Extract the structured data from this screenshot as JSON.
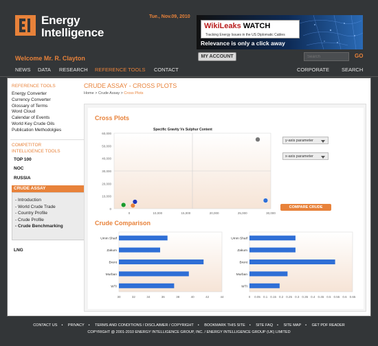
{
  "header": {
    "brand_line1": "Energy",
    "brand_line2": "Intelligence",
    "date": "Tue., Nov.09, 2010",
    "banner": {
      "title_part1": "WikiLeaks",
      "title_part2": " WATCH",
      "subtitle": "Tracking Energy Issues in the US Diplomatic Cables",
      "tagline": "Relevance is only a click away"
    },
    "welcome": "Welcome Mr. R. Clayton",
    "my_account": "MY ACCOUNT",
    "search_placeholder": "Search",
    "go": "GO"
  },
  "nav": {
    "items": [
      "NEWS",
      "DATA",
      "RESEARCH",
      "REFERENCE TOOLS",
      "CONTACT"
    ],
    "right_items": [
      "CORPORATE",
      "SEARCH"
    ]
  },
  "sidebar": {
    "reference_head": "REFERENCE TOOLS",
    "reference_items": [
      "Energy Converter",
      "Currency Converter",
      "Glossary of Terms",
      "Word Cloud",
      "Calendar of Events",
      "World Key Crude Oils",
      "Publication Methodolgies"
    ],
    "competitor_head_1": "COMPETITOR",
    "competitor_head_2": "INTELLIGENCE TOOLS",
    "top100": "TOP 100",
    "noc": "NOC",
    "russia": "RUSSIA",
    "crude_head": "CRUDE ASSAY",
    "crude_items": [
      "- Introduction",
      "- World Crude Trade",
      "- Country Profile",
      "- Crude Profile",
      "- Crude Benchmarking"
    ],
    "lng": "LNG"
  },
  "content": {
    "page_title": "CRUDE ASSAY - CROSS PLOTS",
    "breadcrumb": {
      "home": "Home",
      "sep": " > ",
      "crude": "Crude Assay",
      "current": "Cross Plots"
    },
    "cross_plots_title": "Cross Plots",
    "compare_label": "COMPARE CRUDE",
    "y_param": "y-axis parameter",
    "x_param": "x-axis parameter",
    "crude_comparison_title": "Crude Comparison"
  },
  "chart_data": [
    {
      "type": "scatter",
      "title": "Specific Gravity Vs Sulphur Content",
      "xlim": [
        0,
        30000
      ],
      "ylim": [
        0,
        60000
      ],
      "x_ticks": [
        "0",
        "10,000",
        "15,000",
        "20,000",
        "25,000",
        "30,000"
      ],
      "y_ticks": [
        "0",
        "10,000",
        "20,000",
        "30,000",
        "40,000",
        "50,000",
        "60,000"
      ],
      "points": [
        {
          "x": 1800,
          "y": 3000,
          "color": "#1c9a2c"
        },
        {
          "x": 3600,
          "y": 2500,
          "color": "#e8823a"
        },
        {
          "x": 4000,
          "y": 5500,
          "color": "#2035b8"
        },
        {
          "x": 27500,
          "y": 55000,
          "color": "#777777"
        },
        {
          "x": 29000,
          "y": 6500,
          "color": "#2f6fd6"
        }
      ]
    },
    {
      "type": "bar",
      "categories": [
        "Umm Shaif",
        "Zakum",
        "Brent",
        "Murban",
        "WTI"
      ],
      "values": [
        36.6,
        35.6,
        41.5,
        39.5,
        37.5
      ],
      "xlim": [
        30,
        44
      ],
      "x_ticks": [
        "30",
        "32",
        "34",
        "36",
        "38",
        "40",
        "42",
        "44"
      ],
      "color": "#2f6fd6"
    },
    {
      "type": "bar",
      "categories": [
        "Umm Shaif",
        "Zakum",
        "Brent",
        "Murban",
        "WTI"
      ],
      "values": [
        0.29,
        0.29,
        0.54,
        0.24,
        0.19
      ],
      "xlim": [
        0,
        0.65
      ],
      "x_ticks": [
        "0",
        "0.05",
        "0.1",
        "0.15",
        "0.2",
        "0.25",
        "0.3",
        "0.35",
        "0.4",
        "0.45",
        "0.5",
        "0.55",
        "0.6",
        "0.65"
      ],
      "color": "#2f6fd6"
    }
  ],
  "footer": {
    "links": [
      "CONTACT US",
      "PRIVACY",
      "TERMS AND CONDITIONS / DISCLAIMER / COPYRIGHT",
      "BOOKMARK THIS SITE",
      "SITE FAQ",
      "SITE MAP",
      "GET PDF READER"
    ],
    "separator": "•",
    "copyright": "COPYRIGHT @ 2001-2010 ENERGY INTELLIGENCE GROUP, INC. / ENERGY INTELLIGENCE GROUP (UK) LIMITED"
  }
}
